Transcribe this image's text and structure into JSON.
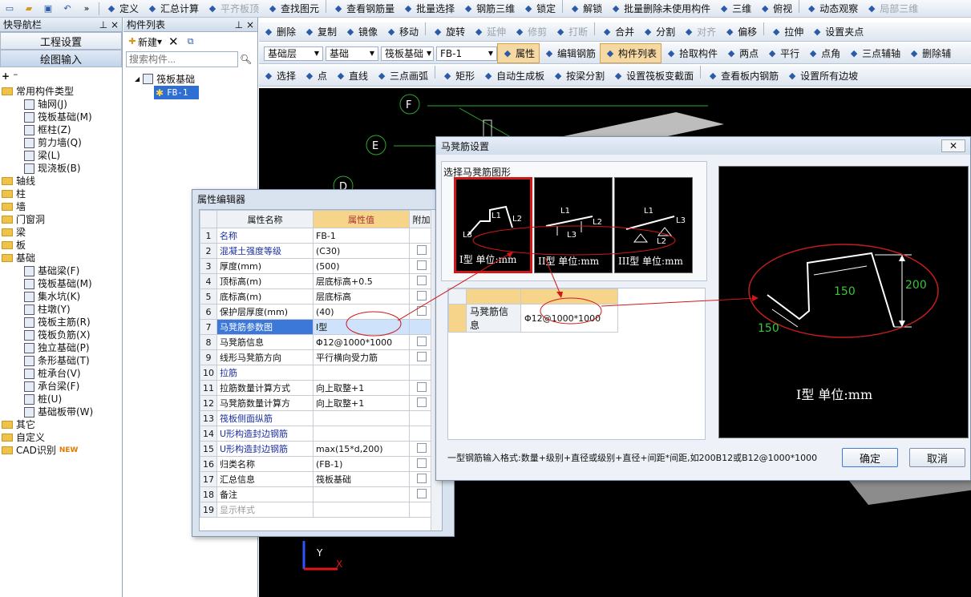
{
  "toolbar1": [
    "定义",
    "汇总计算",
    "平齐板顶",
    "查找图元",
    "查看钢筋量",
    "批量选择",
    "钢筋三维",
    "锁定",
    "解锁",
    "批量删除未使用构件",
    "三维",
    "俯视",
    "动态观察",
    "局部三维"
  ],
  "toolbar2": [
    "删除",
    "复制",
    "镜像",
    "移动",
    "旋转",
    "延伸",
    "修剪",
    "打断",
    "合并",
    "分割",
    "对齐",
    "偏移",
    "拉伸",
    "设置夹点"
  ],
  "toolbar3": {
    "layer": "基础层",
    "category": "基础",
    "type": "筏板基础",
    "element": "FB-1",
    "items": [
      "属性",
      "编辑钢筋",
      "构件列表",
      "拾取构件",
      "两点",
      "平行",
      "点角",
      "三点辅轴",
      "删除辅"
    ]
  },
  "toolbar4": [
    "选择",
    "点",
    "直线",
    "三点画弧",
    "矩形",
    "自动生成板",
    "按梁分割",
    "设置筏板变截面",
    "查看板内钢筋",
    "设置所有边坡"
  ],
  "nav": {
    "title": "快导航栏",
    "btn1": "工程设置",
    "btn2": "绘图输入",
    "tree": [
      {
        "t": "常用构件类型",
        "lvl": 0,
        "f": 1
      },
      {
        "t": "轴网(J)",
        "lvl": 2
      },
      {
        "t": "筏板基础(M)",
        "lvl": 2
      },
      {
        "t": "框柱(Z)",
        "lvl": 2
      },
      {
        "t": "剪力墙(Q)",
        "lvl": 2
      },
      {
        "t": "梁(L)",
        "lvl": 2
      },
      {
        "t": "现浇板(B)",
        "lvl": 2
      },
      {
        "t": "轴线",
        "lvl": 0,
        "f": 1
      },
      {
        "t": "柱",
        "lvl": 0,
        "f": 1
      },
      {
        "t": "墙",
        "lvl": 0,
        "f": 1
      },
      {
        "t": "门窗洞",
        "lvl": 0,
        "f": 1
      },
      {
        "t": "梁",
        "lvl": 0,
        "f": 1
      },
      {
        "t": "板",
        "lvl": 0,
        "f": 1
      },
      {
        "t": "基础",
        "lvl": 0,
        "f": 1
      },
      {
        "t": "基础梁(F)",
        "lvl": 2
      },
      {
        "t": "筏板基础(M)",
        "lvl": 2
      },
      {
        "t": "集水坑(K)",
        "lvl": 2
      },
      {
        "t": "柱墩(Y)",
        "lvl": 2
      },
      {
        "t": "筏板主筋(R)",
        "lvl": 2
      },
      {
        "t": "筏板负筋(X)",
        "lvl": 2
      },
      {
        "t": "独立基础(P)",
        "lvl": 2
      },
      {
        "t": "条形基础(T)",
        "lvl": 2
      },
      {
        "t": "桩承台(V)",
        "lvl": 2
      },
      {
        "t": "承台梁(F)",
        "lvl": 2
      },
      {
        "t": "桩(U)",
        "lvl": 2
      },
      {
        "t": "基础板带(W)",
        "lvl": 2
      },
      {
        "t": "其它",
        "lvl": 0,
        "f": 1
      },
      {
        "t": "自定义",
        "lvl": 0,
        "f": 1
      },
      {
        "t": "CAD识别",
        "lvl": 0,
        "f": 1
      }
    ],
    "new_badge": "NEW"
  },
  "components": {
    "title": "构件列表",
    "new_label": "新建",
    "search_placeholder": "搜索构件...",
    "root": "筏板基础",
    "child": "FB-1"
  },
  "axes": [
    "F",
    "E",
    "D"
  ],
  "canvas_axis": {
    "y": "Y",
    "x": "X"
  },
  "props": {
    "title": "属性编辑器",
    "headers": [
      "属性名称",
      "属性值",
      "附加"
    ],
    "rows": [
      [
        "1",
        "名称",
        "FB-1",
        0,
        1
      ],
      [
        "2",
        "混凝土强度等级",
        "(C30)",
        1,
        1
      ],
      [
        "3",
        "厚度(mm)",
        "(500)",
        1,
        0
      ],
      [
        "4",
        "顶标高(m)",
        "层底标高+0.5",
        1,
        0
      ],
      [
        "5",
        "底标高(m)",
        "层底标高",
        1,
        0
      ],
      [
        "6",
        "保护层厚度(mm)",
        "(40)",
        1,
        0
      ],
      [
        "7",
        "马凳筋参数图",
        "I型",
        0,
        0
      ],
      [
        "8",
        "马凳筋信息",
        "Φ12@1000*1000",
        1,
        0
      ],
      [
        "9",
        "线形马凳筋方向",
        "平行横向受力筋",
        1,
        0
      ],
      [
        "10",
        "拉筋",
        "",
        0,
        1
      ],
      [
        "11",
        "拉筋数量计算方式",
        "向上取整+1",
        1,
        0
      ],
      [
        "12",
        "马凳筋数量计算方",
        "向上取整+1",
        1,
        0
      ],
      [
        "13",
        "筏板侧面纵筋",
        "",
        0,
        1
      ],
      [
        "14",
        "U形构造封边钢筋",
        "",
        0,
        1
      ],
      [
        "15",
        "U形构造封边钢筋",
        "max(15*d,200)",
        1,
        1
      ],
      [
        "16",
        "归类名称",
        "(FB-1)",
        1,
        0
      ],
      [
        "17",
        "汇总信息",
        "筏板基础",
        1,
        0
      ],
      [
        "18",
        "备注",
        "",
        1,
        0
      ],
      [
        "19",
        "显示样式",
        "",
        0,
        0
      ]
    ]
  },
  "dialog": {
    "title": "马凳筋设置",
    "group": "选择马凳筋图形",
    "shapes": [
      {
        "label": "I型 单位:mm"
      },
      {
        "label": "II型 单位:mm"
      },
      {
        "label": "III型 单位:mm"
      }
    ],
    "table": {
      "label": "马凳筋信息",
      "value": "Φ12@1000*1000"
    },
    "preview": {
      "label": "I型 单位:mm",
      "dim_a": "150",
      "dim_b": "150",
      "dim_c": "200"
    },
    "hint": "一型钢筋输入格式:数量+级别+直径或级别+直径+间距*间距,如200B12或B12@1000*1000",
    "ok": "确定",
    "cancel": "取消"
  }
}
